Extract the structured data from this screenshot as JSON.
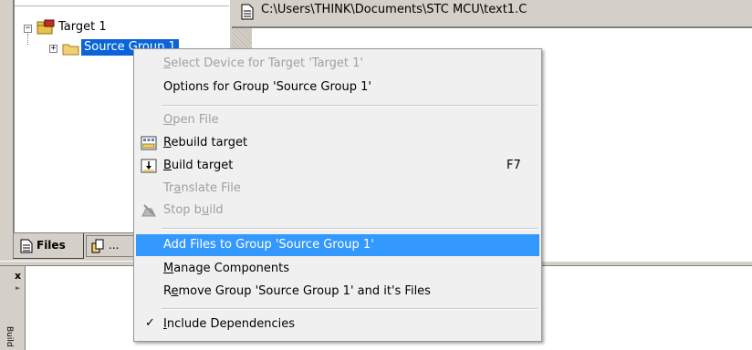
{
  "tree": {
    "target_label": "Target 1",
    "group_label": "Source Group 1"
  },
  "tabs": {
    "files_label": "Files",
    "books_label": "..."
  },
  "editor": {
    "file_path": "C:\\Users\\THINK\\Documents\\STC MCU\\text1.C"
  },
  "output": {
    "close_glyph": "x",
    "side_label": "Build"
  },
  "context_menu": {
    "items": [
      {
        "label": "Select Device for Target 'Target 1'",
        "mnemonic": "S",
        "enabled": false
      },
      {
        "label": "Options for Group 'Source Group 1'",
        "mnemonic": "",
        "enabled": true
      },
      {
        "label": "Open File",
        "mnemonic": "O",
        "enabled": false
      },
      {
        "label": "Rebuild target",
        "mnemonic": "R",
        "enabled": true,
        "icon": "rebuild-icon"
      },
      {
        "label": "Build target",
        "mnemonic": "B",
        "enabled": true,
        "icon": "build-icon",
        "shortcut": "F7"
      },
      {
        "label": "Translate File",
        "mnemonic": "a",
        "enabled": false
      },
      {
        "label": "Stop build",
        "mnemonic": "u",
        "enabled": false,
        "icon": "stop-build-icon"
      },
      {
        "label": "Add Files to Group 'Source Group 1'",
        "mnemonic": "",
        "enabled": true,
        "highlighted": true
      },
      {
        "label": "Manage Components",
        "mnemonic": "M",
        "enabled": true
      },
      {
        "label": "Remove Group 'Source Group 1' and it's Files",
        "mnemonic": "e",
        "enabled": true
      },
      {
        "label": "Include Dependencies",
        "mnemonic": "I",
        "enabled": true,
        "checked": true
      }
    ]
  },
  "colors": {
    "highlight": "#3399ff",
    "tree_selection": "#0a64d8",
    "panel": "#d4d0c8",
    "menu_bg": "#f0f0f0"
  }
}
